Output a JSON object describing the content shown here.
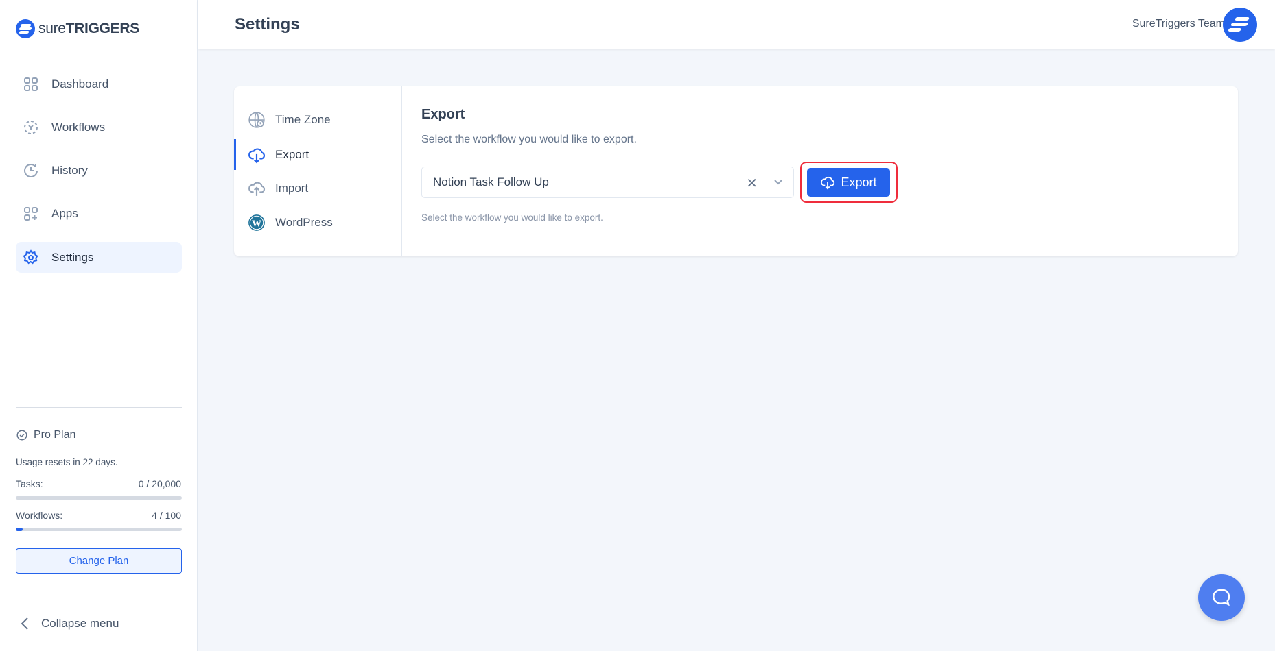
{
  "brand": {
    "logo_light": "sure",
    "logo_bold": "TRIGGERS",
    "accent": "#2563eb"
  },
  "sidebar": {
    "items": [
      {
        "label": "Dashboard",
        "icon": "dashboard-grid-icon"
      },
      {
        "label": "Workflows",
        "icon": "workflow-icon"
      },
      {
        "label": "History",
        "icon": "history-icon"
      },
      {
        "label": "Apps",
        "icon": "apps-icon"
      },
      {
        "label": "Settings",
        "icon": "gear-icon",
        "active": true
      }
    ],
    "plan": {
      "name": "Pro Plan",
      "reset": "Usage resets in 22 days.",
      "tasks_label": "Tasks:",
      "tasks_value": "0 / 20,000",
      "tasks_progress": 0,
      "workflows_label": "Workflows:",
      "workflows_value": "4 / 100",
      "workflows_progress": 0.04,
      "change_plan": "Change Plan"
    },
    "collapse": "Collapse menu"
  },
  "header": {
    "title": "Settings",
    "team": "SureTriggers Team"
  },
  "settings": {
    "tabs": [
      {
        "label": "Time Zone",
        "icon": "globe-clock-icon"
      },
      {
        "label": "Export",
        "icon": "cloud-download-icon",
        "active": true
      },
      {
        "label": "Import",
        "icon": "cloud-upload-icon"
      },
      {
        "label": "WordPress",
        "icon": "wordpress-icon"
      }
    ],
    "export": {
      "title": "Export",
      "subtitle": "Select the workflow you would like to export.",
      "selected": "Notion Task Follow Up",
      "button": "Export",
      "help": "Select the workflow you would like to export."
    }
  }
}
